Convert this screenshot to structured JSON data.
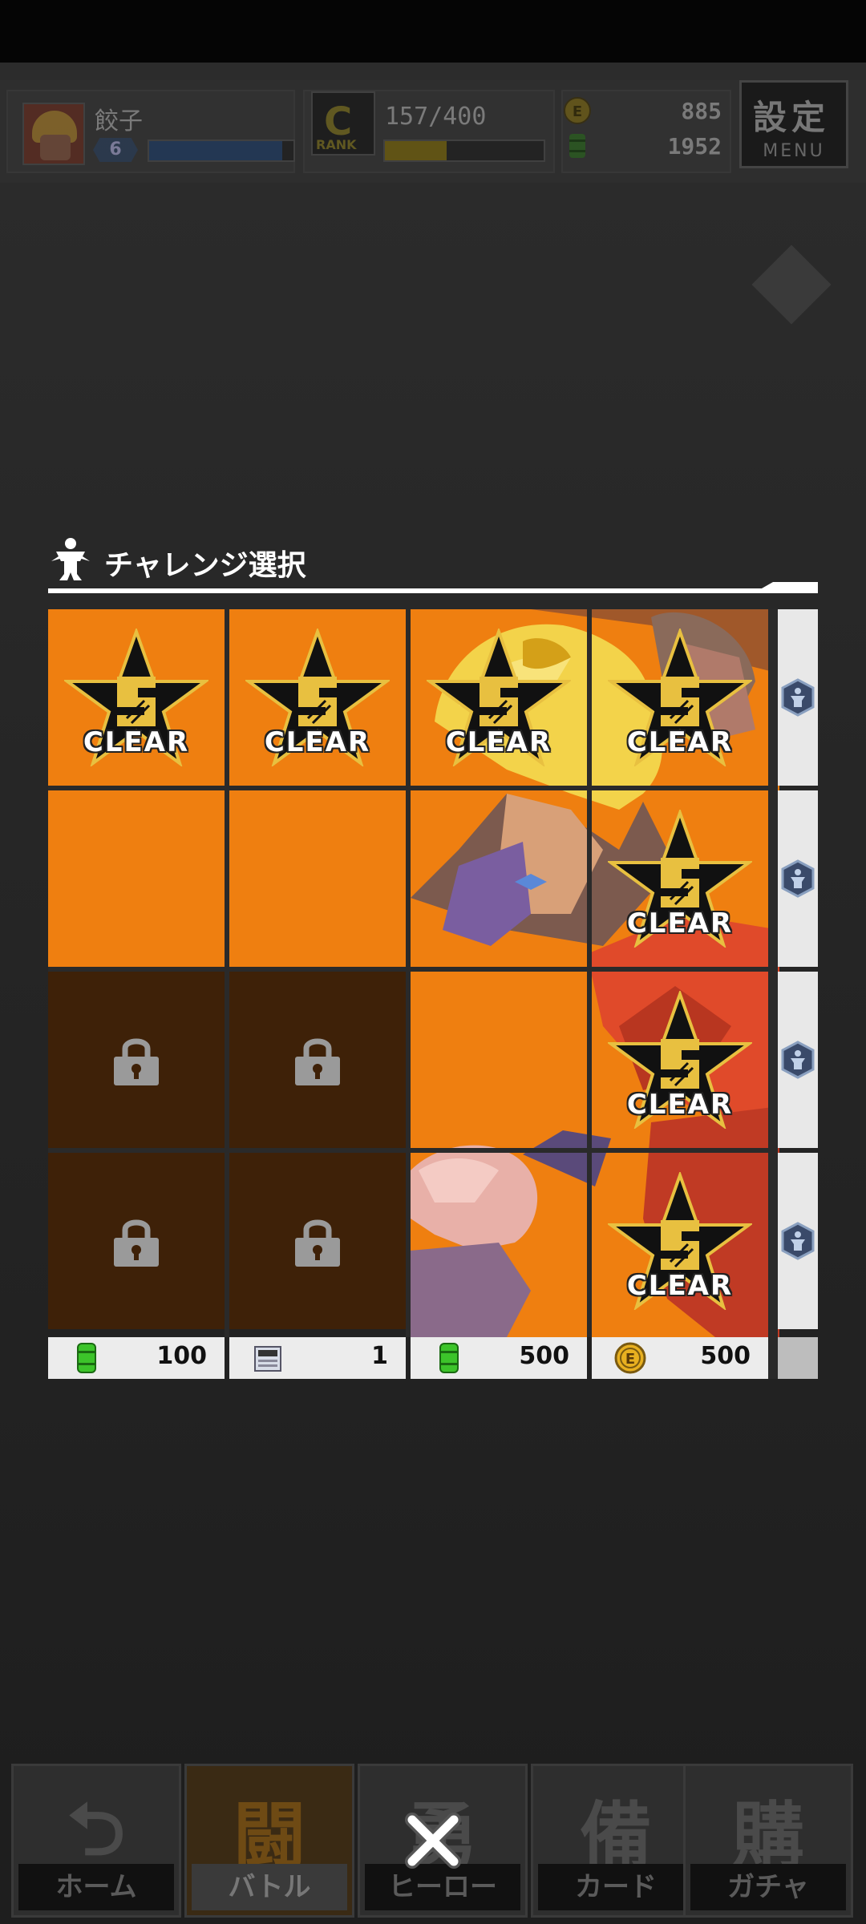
{
  "header": {
    "player_name": "餃子",
    "level": "6",
    "xp_progress": 0.92,
    "rank_label": "RANK",
    "rank_progress_text": "157/400",
    "rank_progress": 0.39,
    "currency_gold": "885",
    "currency_green": "1952",
    "menu_big": "設定",
    "menu_small": "MENU"
  },
  "dialog": {
    "title": "チャレンジ選択",
    "clear_label": "CLEAR",
    "grid": [
      [
        "cleared",
        "cleared",
        "cleared-art",
        "cleared-art"
      ],
      [
        "open",
        "open",
        "art",
        "cleared-art"
      ],
      [
        "locked",
        "locked",
        "art",
        "cleared-art"
      ],
      [
        "locked",
        "locked",
        "art",
        "cleared-art"
      ]
    ],
    "rewards": [
      {
        "icon": "green-barrel-icon",
        "value": "100"
      },
      {
        "icon": "ticket-icon",
        "value": "1"
      },
      {
        "icon": "green-barrel-icon",
        "value": "500"
      },
      {
        "icon": "gold-coin-icon",
        "value": "500"
      }
    ],
    "row_bonus_icons": [
      "hero-medal-icon",
      "hero-medal-icon",
      "hero-medal-icon",
      "hero-medal-icon"
    ]
  },
  "nav": {
    "tabs": [
      {
        "glyph": "⮌",
        "label": "ホーム",
        "active": false
      },
      {
        "glyph": "闘",
        "label": "バトル",
        "active": true
      },
      {
        "glyph": "勇",
        "label": "ヒーロー",
        "active": false
      },
      {
        "glyph": "備",
        "label": "カード",
        "active": false
      },
      {
        "glyph": "購",
        "label": "ガチャ",
        "active": false
      }
    ]
  },
  "colors": {
    "open_cell": "#ef7f10",
    "locked_cell": "#3e2108",
    "reward_bar": "#ececec",
    "badge_gold": "#e8c040"
  }
}
